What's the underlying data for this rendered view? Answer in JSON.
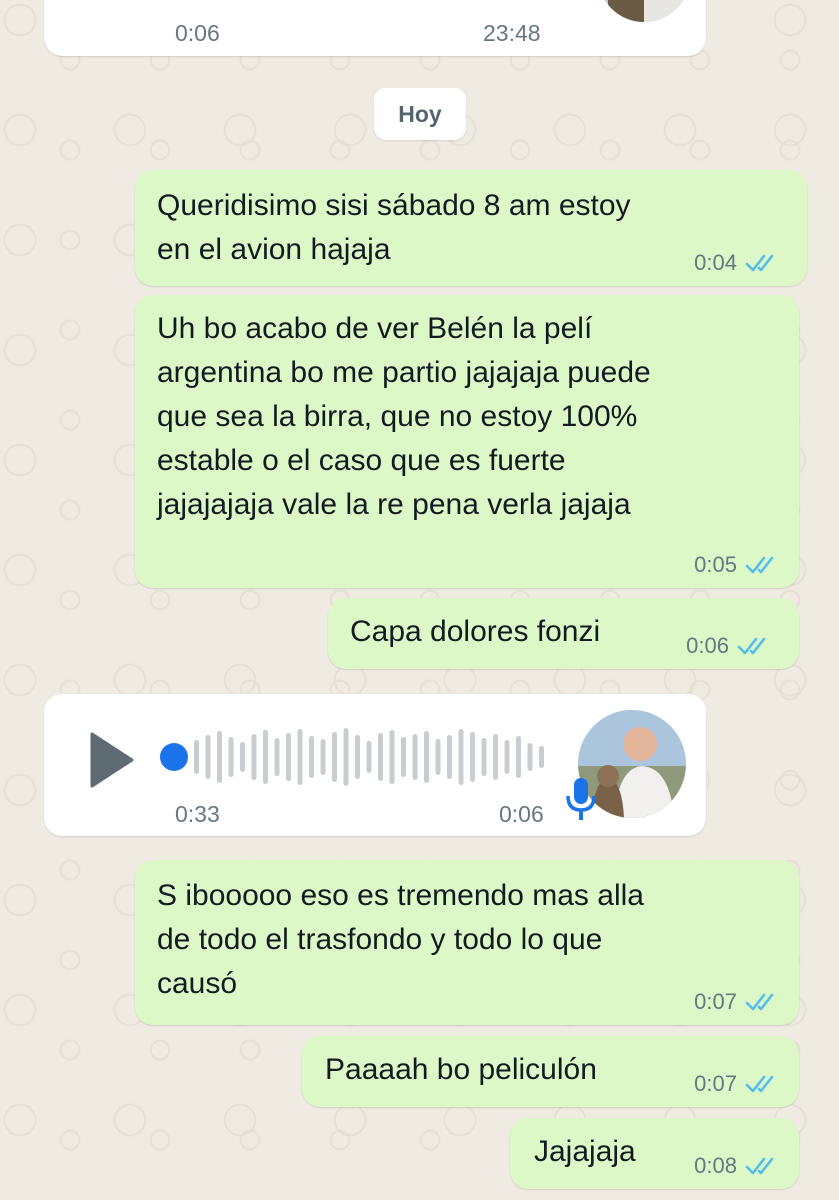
{
  "date_chip": "Hoy",
  "top_voice": {
    "duration": "0:06",
    "time": "23:48"
  },
  "messages": [
    {
      "text": "Queridisimo sisi sábado 8 am estoy\nen el avion hajaja",
      "time": "0:04"
    },
    {
      "text": "Uh bo acabo de ver Belén la pelí\nargentina bo me partio jajajaja puede\nque sea la birra, que no estoy 100%\nestable o el caso que es fuerte\njajajajaja vale la re pena verla jajaja",
      "time": "0:05"
    },
    {
      "text": "Capa dolores fonzi",
      "time": "0:06"
    },
    {
      "text": "S ibooooo eso es tremendo mas alla\nde todo el trasfondo y todo lo que\ncausó",
      "time": "0:07"
    },
    {
      "text": "Paaaah bo peliculón",
      "time": "0:07"
    },
    {
      "text": "Jajajaja",
      "time": "0:08"
    }
  ],
  "voice_message": {
    "duration": "0:33",
    "time": "0:06",
    "play_icon": "play-icon",
    "mic_icon": "mic-icon"
  },
  "colors": {
    "outgoing": "#dcf8c6",
    "incoming": "#ffffff",
    "tick_read": "#53bdeb",
    "accent": "#1a73e8"
  }
}
